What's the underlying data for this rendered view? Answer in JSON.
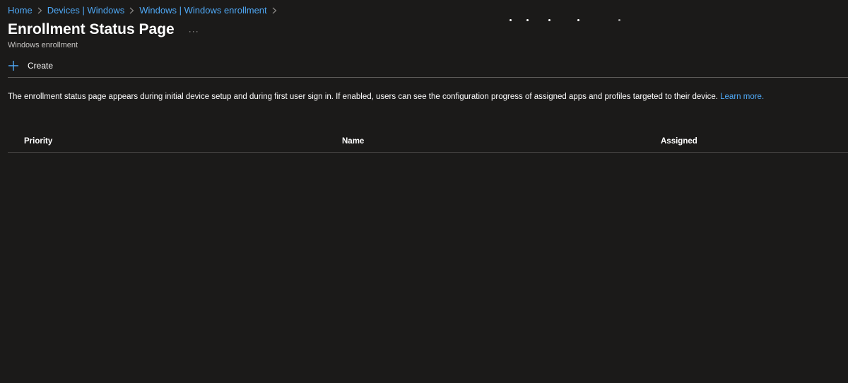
{
  "breadcrumb": {
    "items": [
      "Home",
      "Devices | Windows",
      "Windows | Windows enrollment"
    ]
  },
  "page": {
    "title": "Enrollment Status Page",
    "more_label": "···",
    "subtitle": "Windows enrollment"
  },
  "commands": {
    "create_label": "Create",
    "create_icon": "plus-icon"
  },
  "description": {
    "text": "The enrollment status page appears during initial device setup and during first user sign in. If enabled, users can see the configuration progress of assigned apps and profiles targeted to their device. ",
    "link": "Learn more."
  },
  "table": {
    "columns": [
      "Priority",
      "Name",
      "Assigned"
    ],
    "rows": []
  },
  "colors": {
    "background": "#1b1a19",
    "link": "#4fa8f5",
    "text": "#ffffff",
    "divider": "#605e5c"
  }
}
